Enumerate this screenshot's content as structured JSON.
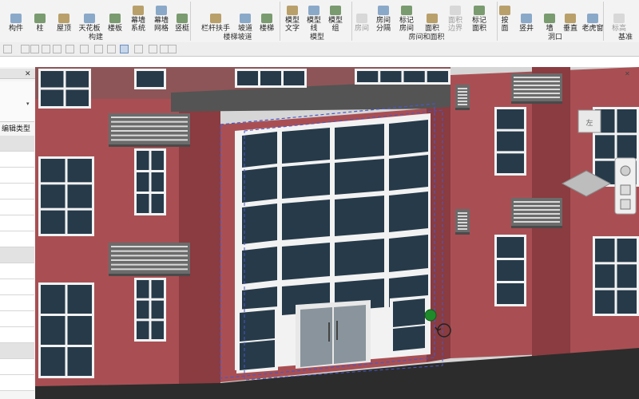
{
  "ribbon": {
    "buttons": [
      {
        "label": "构件",
        "disabled": false
      },
      {
        "label": "柱",
        "disabled": false
      },
      {
        "label": "屋顶",
        "disabled": false
      },
      {
        "label": "天花板",
        "disabled": false
      },
      {
        "label": "楼板",
        "disabled": false
      },
      {
        "label": "幕墙\n系统",
        "disabled": false
      },
      {
        "label": "幕墙\n网格",
        "disabled": false
      },
      {
        "label": "竖梃",
        "disabled": false
      },
      {
        "label": "栏杆扶手",
        "disabled": false
      },
      {
        "label": "坡道",
        "disabled": false
      },
      {
        "label": "楼梯",
        "disabled": false
      },
      {
        "label": "模型\n文字",
        "disabled": false
      },
      {
        "label": "模型\n线",
        "disabled": false
      },
      {
        "label": "模型\n组",
        "disabled": false
      },
      {
        "label": "房间",
        "disabled": true
      },
      {
        "label": "房间\n分隔",
        "disabled": false
      },
      {
        "label": "标记\n房间",
        "disabled": false
      },
      {
        "label": "面积",
        "disabled": false
      },
      {
        "label": "面积\n边界",
        "disabled": true
      },
      {
        "label": "标记\n面积",
        "disabled": false
      },
      {
        "label": "按\n面",
        "disabled": false
      },
      {
        "label": "竖井",
        "disabled": false
      },
      {
        "label": "墙",
        "disabled": false
      },
      {
        "label": "垂直",
        "disabled": false
      },
      {
        "label": "老虎窗",
        "disabled": false
      },
      {
        "label": "标高",
        "disabled": true
      }
    ],
    "groups": [
      "构建",
      "楼梯坡道",
      "模型",
      "房间和面积",
      "洞口",
      "基准"
    ]
  },
  "properties_panel": {
    "close_glyph": "✕",
    "edit_type_label": "编辑类型"
  },
  "viewport": {
    "close_glyph": "✕",
    "viewcube_label": "左"
  },
  "colors": {
    "brick": "#a94f53",
    "brick_dark": "#8a3c40",
    "glass": "#263a4a",
    "frame": "#f2f2f2",
    "selection": "#4a57c8"
  }
}
